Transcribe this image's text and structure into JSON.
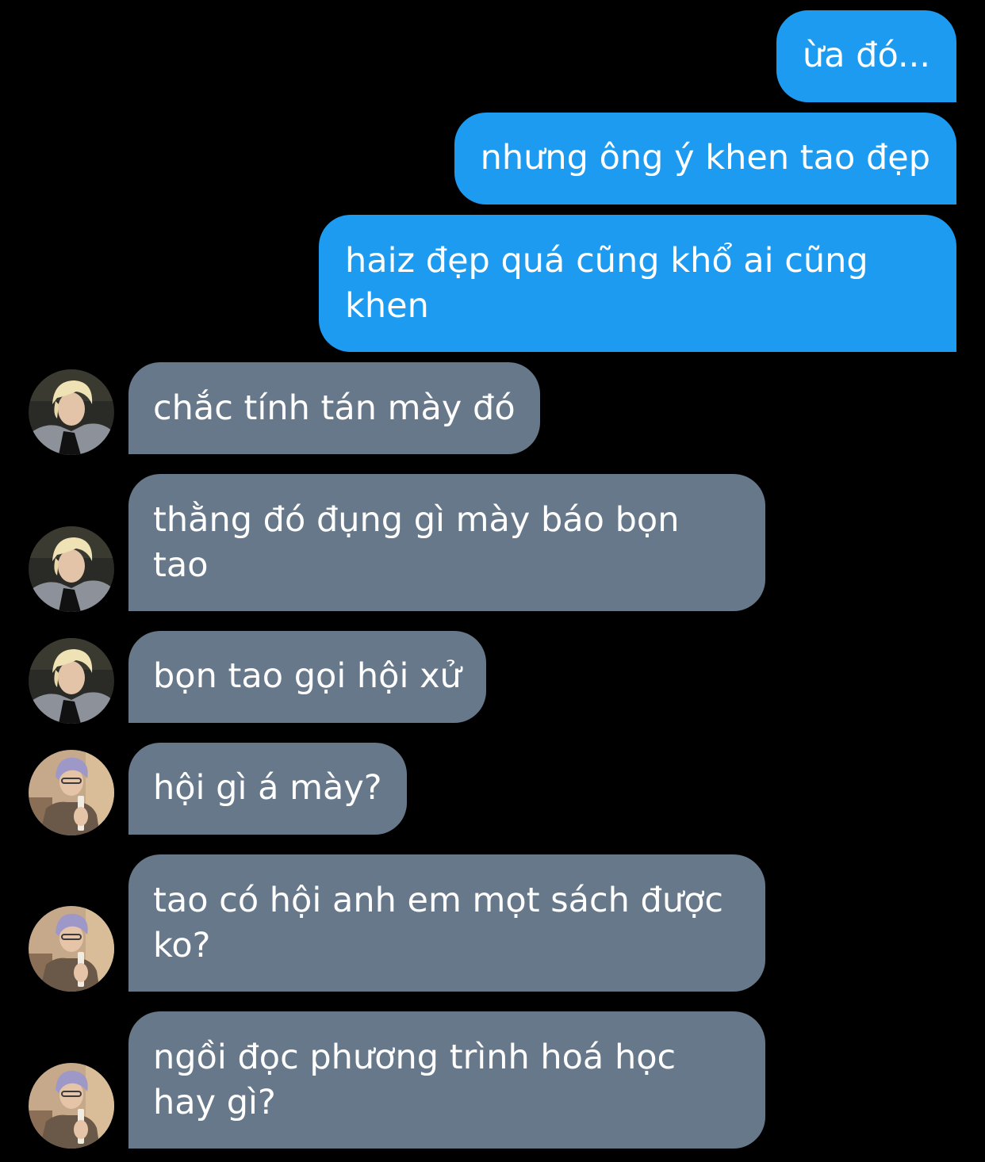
{
  "messages": [
    {
      "id": "m1",
      "direction": "sent",
      "text": "ừa đó..."
    },
    {
      "id": "m2",
      "direction": "sent",
      "text": "nhưng ông ý khen tao đẹp"
    },
    {
      "id": "m3",
      "direction": "sent",
      "text": "haiz đẹp quá cũng khổ ai cũng\nkhen"
    },
    {
      "id": "m4",
      "direction": "received",
      "sender_avatar": "blond-avatar",
      "text": "chắc tính tán mày đó"
    },
    {
      "id": "m5",
      "direction": "received",
      "sender_avatar": "blond-avatar",
      "text": "thằng đó đụng gì mày báo bọn\ntao"
    },
    {
      "id": "m6",
      "direction": "received",
      "sender_avatar": "blond-avatar",
      "text": "bọn tao gọi hội xử"
    },
    {
      "id": "m7",
      "direction": "received",
      "sender_avatar": "lilac-hair-avatar",
      "text": "hội gì á mày?"
    },
    {
      "id": "m8",
      "direction": "received",
      "sender_avatar": "lilac-hair-avatar",
      "text": "tao có hội anh em mọt sách được\nko?"
    },
    {
      "id": "m9",
      "direction": "received",
      "sender_avatar": "lilac-hair-avatar",
      "text": "ngồi đọc phương trình hoá học\nhay gì?"
    }
  ],
  "colors": {
    "background": "#000000",
    "sent_bubble": "#1d9bf0",
    "received_bubble": "#66788a",
    "text": "#ffffff"
  }
}
